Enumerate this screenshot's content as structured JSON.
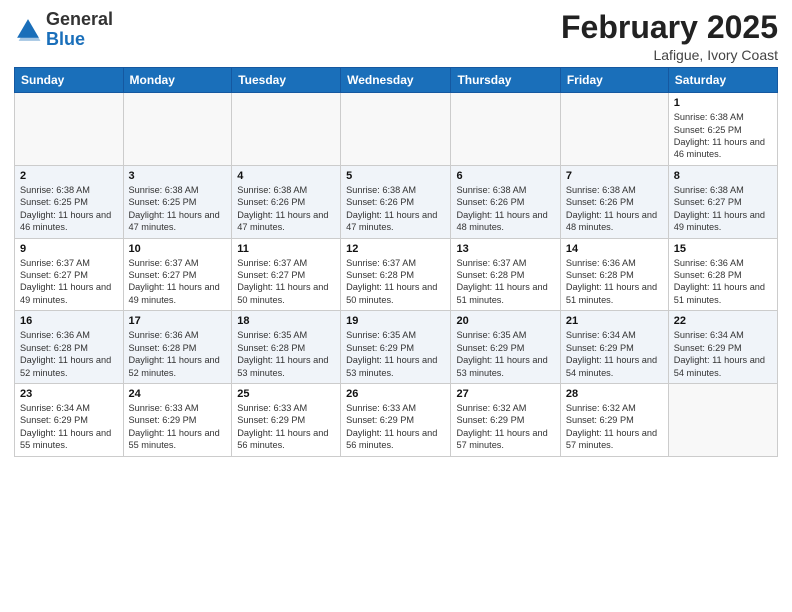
{
  "logo": {
    "general": "General",
    "blue": "Blue"
  },
  "title": "February 2025",
  "location": "Lafigue, Ivory Coast",
  "days_of_week": [
    "Sunday",
    "Monday",
    "Tuesday",
    "Wednesday",
    "Thursday",
    "Friday",
    "Saturday"
  ],
  "weeks": [
    [
      {
        "day": "",
        "info": ""
      },
      {
        "day": "",
        "info": ""
      },
      {
        "day": "",
        "info": ""
      },
      {
        "day": "",
        "info": ""
      },
      {
        "day": "",
        "info": ""
      },
      {
        "day": "",
        "info": ""
      },
      {
        "day": "1",
        "info": "Sunrise: 6:38 AM\nSunset: 6:25 PM\nDaylight: 11 hours and 46 minutes."
      }
    ],
    [
      {
        "day": "2",
        "info": "Sunrise: 6:38 AM\nSunset: 6:25 PM\nDaylight: 11 hours and 46 minutes."
      },
      {
        "day": "3",
        "info": "Sunrise: 6:38 AM\nSunset: 6:25 PM\nDaylight: 11 hours and 47 minutes."
      },
      {
        "day": "4",
        "info": "Sunrise: 6:38 AM\nSunset: 6:26 PM\nDaylight: 11 hours and 47 minutes."
      },
      {
        "day": "5",
        "info": "Sunrise: 6:38 AM\nSunset: 6:26 PM\nDaylight: 11 hours and 47 minutes."
      },
      {
        "day": "6",
        "info": "Sunrise: 6:38 AM\nSunset: 6:26 PM\nDaylight: 11 hours and 48 minutes."
      },
      {
        "day": "7",
        "info": "Sunrise: 6:38 AM\nSunset: 6:26 PM\nDaylight: 11 hours and 48 minutes."
      },
      {
        "day": "8",
        "info": "Sunrise: 6:38 AM\nSunset: 6:27 PM\nDaylight: 11 hours and 49 minutes."
      }
    ],
    [
      {
        "day": "9",
        "info": "Sunrise: 6:37 AM\nSunset: 6:27 PM\nDaylight: 11 hours and 49 minutes."
      },
      {
        "day": "10",
        "info": "Sunrise: 6:37 AM\nSunset: 6:27 PM\nDaylight: 11 hours and 49 minutes."
      },
      {
        "day": "11",
        "info": "Sunrise: 6:37 AM\nSunset: 6:27 PM\nDaylight: 11 hours and 50 minutes."
      },
      {
        "day": "12",
        "info": "Sunrise: 6:37 AM\nSunset: 6:28 PM\nDaylight: 11 hours and 50 minutes."
      },
      {
        "day": "13",
        "info": "Sunrise: 6:37 AM\nSunset: 6:28 PM\nDaylight: 11 hours and 51 minutes."
      },
      {
        "day": "14",
        "info": "Sunrise: 6:36 AM\nSunset: 6:28 PM\nDaylight: 11 hours and 51 minutes."
      },
      {
        "day": "15",
        "info": "Sunrise: 6:36 AM\nSunset: 6:28 PM\nDaylight: 11 hours and 51 minutes."
      }
    ],
    [
      {
        "day": "16",
        "info": "Sunrise: 6:36 AM\nSunset: 6:28 PM\nDaylight: 11 hours and 52 minutes."
      },
      {
        "day": "17",
        "info": "Sunrise: 6:36 AM\nSunset: 6:28 PM\nDaylight: 11 hours and 52 minutes."
      },
      {
        "day": "18",
        "info": "Sunrise: 6:35 AM\nSunset: 6:28 PM\nDaylight: 11 hours and 53 minutes."
      },
      {
        "day": "19",
        "info": "Sunrise: 6:35 AM\nSunset: 6:29 PM\nDaylight: 11 hours and 53 minutes."
      },
      {
        "day": "20",
        "info": "Sunrise: 6:35 AM\nSunset: 6:29 PM\nDaylight: 11 hours and 53 minutes."
      },
      {
        "day": "21",
        "info": "Sunrise: 6:34 AM\nSunset: 6:29 PM\nDaylight: 11 hours and 54 minutes."
      },
      {
        "day": "22",
        "info": "Sunrise: 6:34 AM\nSunset: 6:29 PM\nDaylight: 11 hours and 54 minutes."
      }
    ],
    [
      {
        "day": "23",
        "info": "Sunrise: 6:34 AM\nSunset: 6:29 PM\nDaylight: 11 hours and 55 minutes."
      },
      {
        "day": "24",
        "info": "Sunrise: 6:33 AM\nSunset: 6:29 PM\nDaylight: 11 hours and 55 minutes."
      },
      {
        "day": "25",
        "info": "Sunrise: 6:33 AM\nSunset: 6:29 PM\nDaylight: 11 hours and 56 minutes."
      },
      {
        "day": "26",
        "info": "Sunrise: 6:33 AM\nSunset: 6:29 PM\nDaylight: 11 hours and 56 minutes."
      },
      {
        "day": "27",
        "info": "Sunrise: 6:32 AM\nSunset: 6:29 PM\nDaylight: 11 hours and 57 minutes."
      },
      {
        "day": "28",
        "info": "Sunrise: 6:32 AM\nSunset: 6:29 PM\nDaylight: 11 hours and 57 minutes."
      },
      {
        "day": "",
        "info": ""
      }
    ]
  ]
}
